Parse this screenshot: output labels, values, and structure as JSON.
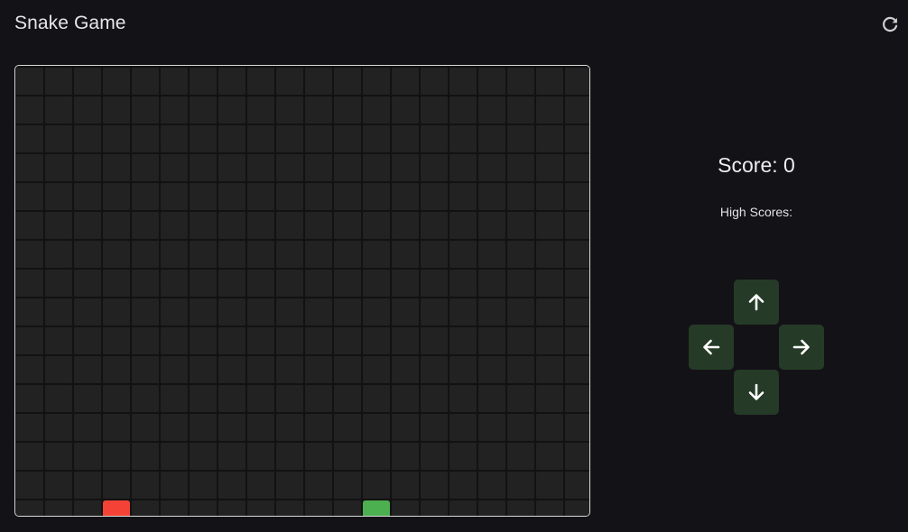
{
  "header": {
    "title": "Snake Game",
    "restart_icon": "refresh-icon"
  },
  "game": {
    "columns": 20,
    "visible_rows": 16,
    "snake_head": {
      "col": 12,
      "row": 15
    },
    "food": {
      "col": 3,
      "row": 15
    },
    "colors": {
      "snake": "#4caf50",
      "food": "#f44336",
      "cell": "#222222",
      "background": "#131217",
      "control": "#253b27"
    }
  },
  "panel": {
    "score_label": "Score: 0",
    "high_scores_label": "High Scores:",
    "controls": {
      "up_icon": "arrow-up-icon",
      "left_icon": "arrow-left-icon",
      "right_icon": "arrow-right-icon",
      "down_icon": "arrow-down-icon"
    }
  }
}
